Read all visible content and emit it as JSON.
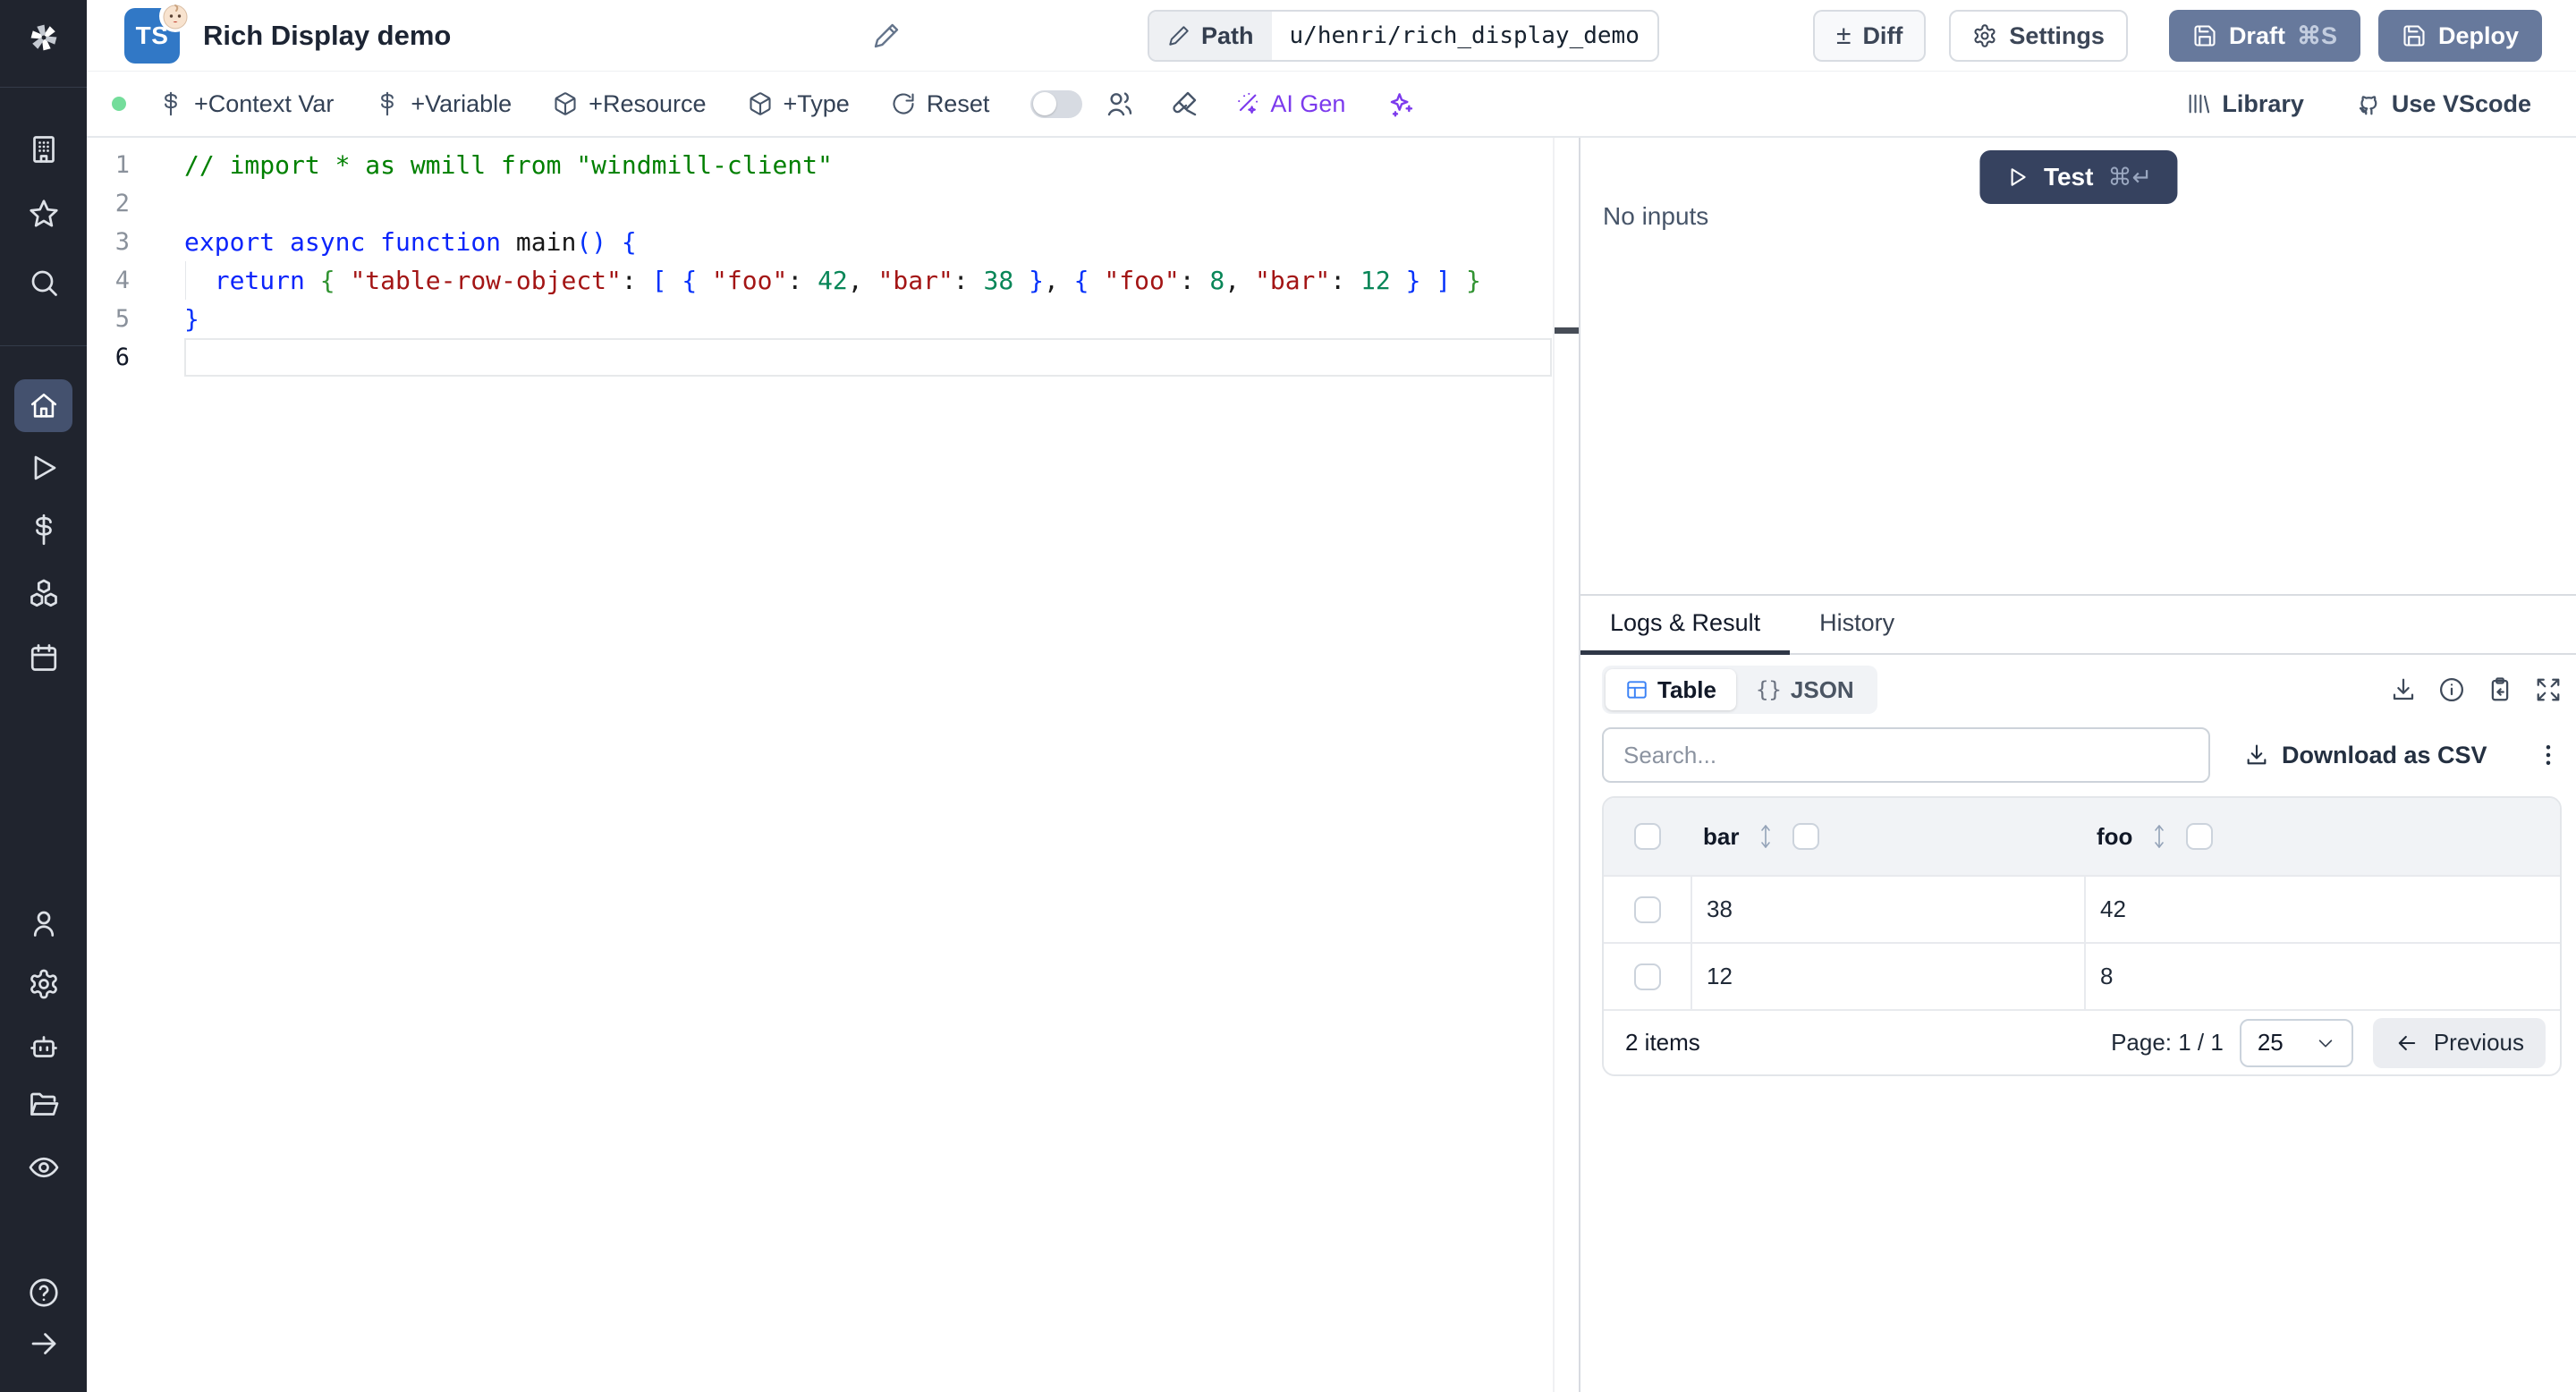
{
  "app": {
    "title": "Rich Display demo",
    "language_badge": "TS"
  },
  "header": {
    "path_label": "Path",
    "path_value": "u/henri/rich_display_demo",
    "diff_label": "Diff",
    "settings_label": "Settings",
    "draft_label": "Draft",
    "draft_shortcut": "⌘S",
    "deploy_label": "Deploy"
  },
  "toolbar": {
    "context_var_label": "+Context Var",
    "variable_label": "+Variable",
    "resource_label": "+Resource",
    "type_label": "+Type",
    "reset_label": "Reset",
    "ai_gen_label": "AI Gen",
    "library_label": "Library",
    "vscode_label": "Use VScode"
  },
  "editor": {
    "lines": [
      {
        "number": "1",
        "tokens": [
          {
            "t": "// import * as wmill from \"windmill-client\"",
            "c": "comment"
          }
        ]
      },
      {
        "number": "2",
        "tokens": []
      },
      {
        "number": "3",
        "tokens": [
          {
            "t": "export",
            "c": "kw"
          },
          {
            "t": " ",
            "c": "plain"
          },
          {
            "t": "async",
            "c": "kw"
          },
          {
            "t": " ",
            "c": "plain"
          },
          {
            "t": "function",
            "c": "kw"
          },
          {
            "t": " ",
            "c": "plain"
          },
          {
            "t": "main",
            "c": "fn"
          },
          {
            "t": "(",
            "c": "br1"
          },
          {
            "t": ")",
            "c": "br1"
          },
          {
            "t": " ",
            "c": "plain"
          },
          {
            "t": "{",
            "c": "br1"
          }
        ]
      },
      {
        "number": "4",
        "tokens": [
          {
            "t": "  ",
            "c": "plain"
          },
          {
            "t": "return",
            "c": "kw"
          },
          {
            "t": " ",
            "c": "plain"
          },
          {
            "t": "{",
            "c": "br2"
          },
          {
            "t": " ",
            "c": "plain"
          },
          {
            "t": "\"table-row-object\"",
            "c": "str"
          },
          {
            "t": ": ",
            "c": "plain"
          },
          {
            "t": "[",
            "c": "br1"
          },
          {
            "t": " ",
            "c": "plain"
          },
          {
            "t": "{",
            "c": "br1"
          },
          {
            "t": " ",
            "c": "plain"
          },
          {
            "t": "\"foo\"",
            "c": "str"
          },
          {
            "t": ": ",
            "c": "plain"
          },
          {
            "t": "42",
            "c": "num"
          },
          {
            "t": ", ",
            "c": "plain"
          },
          {
            "t": "\"bar\"",
            "c": "str"
          },
          {
            "t": ": ",
            "c": "plain"
          },
          {
            "t": "38",
            "c": "num"
          },
          {
            "t": " ",
            "c": "plain"
          },
          {
            "t": "}",
            "c": "br1"
          },
          {
            "t": ", ",
            "c": "plain"
          },
          {
            "t": "{",
            "c": "br1"
          },
          {
            "t": " ",
            "c": "plain"
          },
          {
            "t": "\"foo\"",
            "c": "str"
          },
          {
            "t": ": ",
            "c": "plain"
          },
          {
            "t": "8",
            "c": "num"
          },
          {
            "t": ", ",
            "c": "plain"
          },
          {
            "t": "\"bar\"",
            "c": "str"
          },
          {
            "t": ": ",
            "c": "plain"
          },
          {
            "t": "12",
            "c": "num"
          },
          {
            "t": " ",
            "c": "plain"
          },
          {
            "t": "}",
            "c": "br1"
          },
          {
            "t": " ",
            "c": "plain"
          },
          {
            "t": "]",
            "c": "br1"
          },
          {
            "t": " ",
            "c": "plain"
          },
          {
            "t": "}",
            "c": "br2"
          }
        ]
      },
      {
        "number": "5",
        "tokens": [
          {
            "t": "}",
            "c": "br1"
          }
        ]
      },
      {
        "number": "6",
        "tokens": []
      }
    ]
  },
  "run_panel": {
    "no_inputs_text": "No inputs",
    "test_label": "Test",
    "test_shortcut": "⌘↵"
  },
  "result_panel": {
    "tabs": [
      {
        "label": "Logs & Result"
      },
      {
        "label": "History"
      }
    ],
    "view_toggle": [
      {
        "label": "Table"
      },
      {
        "label": "JSON",
        "glyph": "{}"
      }
    ],
    "search_placeholder": "Search...",
    "download_csv_label": "Download as CSV",
    "table": {
      "columns": [
        "bar",
        "foo"
      ],
      "rows": [
        [
          "38",
          "42"
        ],
        [
          "12",
          "8"
        ]
      ],
      "items_text": "2 items",
      "page_text": "Page: 1 / 1",
      "page_size": "25",
      "previous_label": "Previous"
    }
  },
  "colors": {
    "ts_badge": "#3178C6",
    "ai_accent": "#7C3AED",
    "draft_deploy_button": "#67799C",
    "test_button": "#36425F",
    "status_dot": "#74DD9B",
    "table_view_icon": "#3B82F6",
    "sidebar_bg": "#20242E"
  }
}
